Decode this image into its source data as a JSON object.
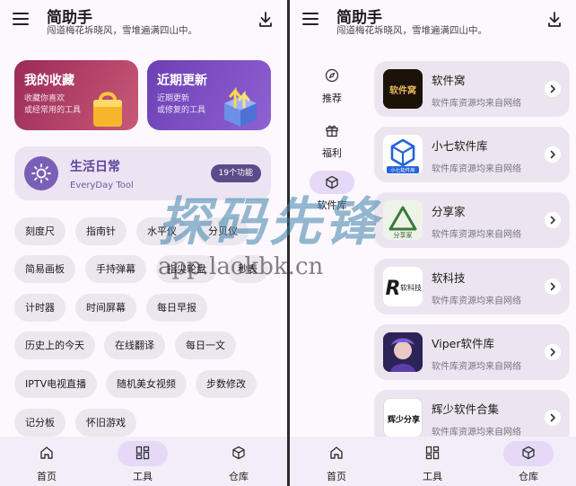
{
  "app": {
    "title": "简助手",
    "subtitle": "闯道梅花坼晓风，雪堆遍满四山中。"
  },
  "left": {
    "cards": [
      {
        "title": "我的收藏",
        "line1": "收藏你喜欢",
        "line2": "或经常用的工具"
      },
      {
        "title": "近期更新",
        "line1": "近期更新",
        "line2": "或修复的工具"
      }
    ],
    "life": {
      "title": "生活日常",
      "subtitle": "EveryDay Tool",
      "badge": "19个功能"
    },
    "chips": [
      "刻度尺",
      "指南针",
      "水平仪",
      "分贝仪",
      "简易画板",
      "手持弹幕",
      "指尖轮盘",
      "秒表",
      "计时器",
      "时间屏幕",
      "每日早报",
      "历史上的今天",
      "在线翻译",
      "每日一文",
      "IPTV电视直播",
      "随机美女视频",
      "步数修改",
      "记分板",
      "怀旧游戏"
    ]
  },
  "right": {
    "rail": [
      {
        "label": "推荐",
        "icon": "compass-icon"
      },
      {
        "label": "福利",
        "icon": "gift-icon"
      },
      {
        "label": "软件库",
        "icon": "package-icon"
      }
    ],
    "repos": [
      {
        "name": "软件窝",
        "desc": "软件库资源均来自网络",
        "logo_text": "软件窝"
      },
      {
        "name": "小七软件库",
        "desc": "软件库资源均来自网络",
        "logo_text": "小七软件库"
      },
      {
        "name": "分享家",
        "desc": "软件库资源均来自网络",
        "logo_text": "分享家"
      },
      {
        "name": "软科技",
        "desc": "软件库资源均来自网络",
        "logo_text": "软科技"
      },
      {
        "name": "Viper软件库",
        "desc": "软件库资源均来自网络",
        "logo_text": ""
      },
      {
        "name": "辉少软件合集",
        "desc": "软件库资源均来自网络",
        "logo_text": "辉少分享"
      }
    ]
  },
  "nav": [
    {
      "label": "首页",
      "icon": "home-icon"
    },
    {
      "label": "工具",
      "icon": "grid-icon"
    },
    {
      "label": "仓库",
      "icon": "package-icon"
    }
  ],
  "watermark": {
    "cn": "探码先锋",
    "url": "app.laokbk.cn"
  },
  "colors": {
    "accent": "#7b5fb6",
    "active_pill": "#e6d9f7",
    "fav_card": "#b84467",
    "recent_card": "#7b4fc6"
  }
}
